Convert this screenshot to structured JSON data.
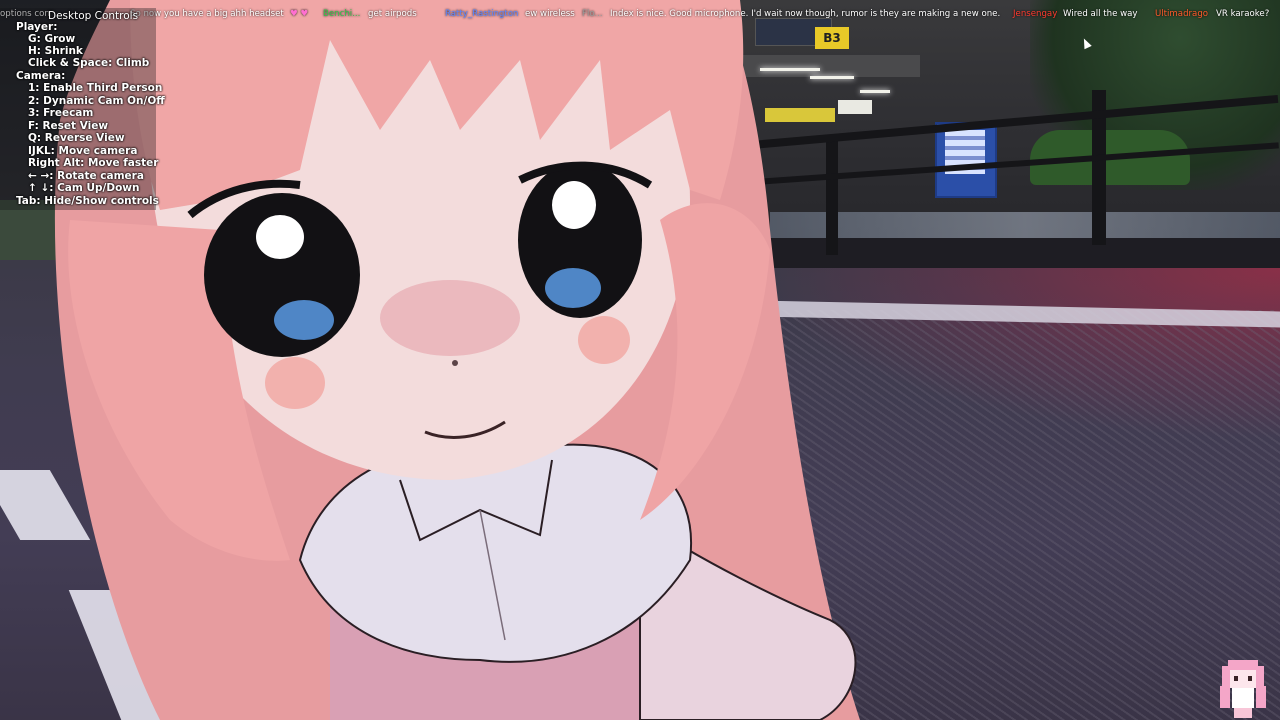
{
  "controls": {
    "header": "Desktop Controls",
    "lines": [
      "Player:",
      "G: Grow",
      "H: Shrink",
      "Click & Space: Climb",
      "Camera:",
      "1: Enable Third Person",
      "2: Dynamic Cam On/Off",
      "3: Freecam",
      "F: Reset View",
      "Q: Reverse View",
      "IJKL: Move camera",
      "Right Alt: Move faster",
      "← →: Rotate camera",
      "↑  ↓: Cam Up/Down",
      "Tab: Hide/Show controls"
    ]
  },
  "chat": {
    "prefix": "options con",
    "messages": [
      {
        "text": "So now you have a big ahh headset"
      },
      {
        "user": "Benchi...",
        "text": "get airpods"
      },
      {
        "user": "Ratty_Rastington",
        "text": "ew wireless"
      },
      {
        "user": "Flo...",
        "text": "Index is nice. Good microphone. I'd wait now though, rumor is they are making a new one."
      },
      {
        "user": "Jensengay",
        "text": "Wired all the way"
      },
      {
        "user": "Ultimadrago",
        "text": "VR karaoke?"
      }
    ]
  },
  "scene": {
    "sign_label": "B3",
    "colors": {
      "hair": "#f0a6a6",
      "hair_shadow": "#d78a8e",
      "skin": "#f4dede",
      "eye_blue": "#4f86c6",
      "collar": "#ece8f2",
      "road": "#403c50",
      "accent_red": "#c82846"
    }
  }
}
